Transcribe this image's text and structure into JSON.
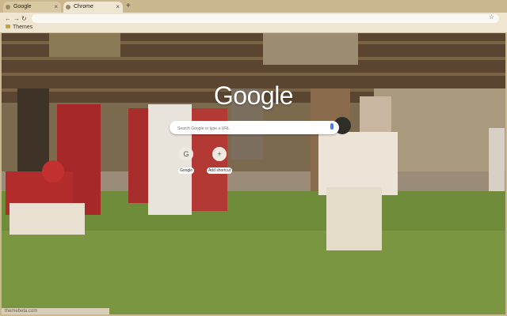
{
  "tabs": [
    {
      "label": "Google",
      "active": false
    },
    {
      "label": "Chrome",
      "active": true
    }
  ],
  "toolbar": {
    "back_icon": "back-arrow-icon",
    "forward_icon": "forward-arrow-icon",
    "reload_icon": "reload-icon",
    "omnibox_value": ""
  },
  "bookmarks": [
    {
      "label": "Themes"
    }
  ],
  "ntp": {
    "logo": "Google",
    "search_placeholder": "Search Google or type a URL",
    "shortcuts": [
      {
        "label": "Google",
        "icon": "G"
      },
      {
        "label": "Add shortcut",
        "icon": "+"
      }
    ]
  },
  "credit": "themebeta.com",
  "colors": {
    "frame": "#cbb78e",
    "toolbar": "#efe6d1",
    "field": "#6f8c3a"
  }
}
